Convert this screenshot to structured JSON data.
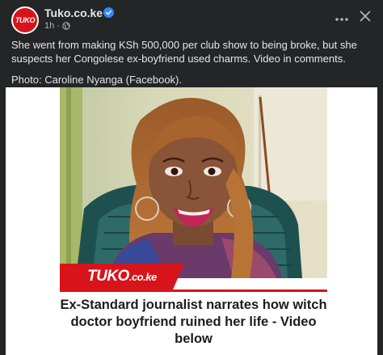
{
  "header": {
    "page_name": "Tuko.co.ke",
    "time_ago": "1h",
    "separator": "·",
    "avatar_text": "TUKO"
  },
  "caption": {
    "line1": "She went from making KSh 500,000 per club show to being broke, but she suspects her Congolese ex-boyfriend used charms. Video in comments.",
    "line2": "Photo: Caroline Nyanga (Facebook)."
  },
  "media": {
    "brand_name": "TUKO",
    "brand_suffix": ".co.ke",
    "headline": "Ex-Standard journalist narrates how witch doctor boyfriend ruined her life - Video below"
  },
  "colors": {
    "background": "#242526",
    "brand_red": "#d7141a",
    "verified_blue": "#2d88ff",
    "text_primary": "#e4e6eb",
    "text_secondary": "#b0b3b8"
  },
  "icons": [
    "verified-icon",
    "globe-icon",
    "more-options-icon",
    "close-icon"
  ]
}
